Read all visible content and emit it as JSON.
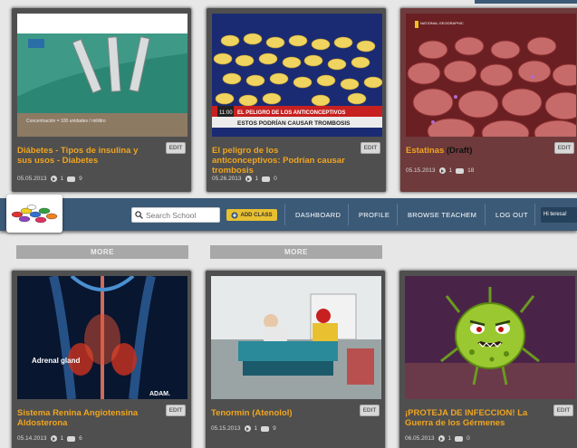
{
  "navbar": {
    "search_placeholder": "Search School",
    "add_class": "ADD CLASS",
    "links": [
      "DASHBOARD",
      "PROFILE",
      "BROWSE TEACHEM",
      "LOG OUT"
    ],
    "user": "Hi teresa!"
  },
  "more_label": "MORE",
  "cards": [
    {
      "title": "Diábetes - Tipos de insulina y sus usos - Diabetes",
      "tag": "",
      "date": "05.05.2013",
      "views": "1",
      "comments": "9",
      "edit": "EDIT",
      "caption": "Concentración = 100 unidades / mililitro"
    },
    {
      "title": "El peligro de los anticonceptivos: Podrían causar trombosis",
      "tag": "",
      "date": "05.26.2013",
      "views": "1",
      "comments": "0",
      "edit": "EDIT",
      "caption": "EL PELIGRO DE LOS ANTICONCEPTIVOS",
      "caption2": "ESTOS PODRÍAN CAUSAR TROMBOSIS",
      "clock": "11:00"
    },
    {
      "title": "Estatinas",
      "tag": " (Draft)",
      "date": "05.15.2013",
      "views": "1",
      "comments": "18",
      "edit": "EDIT",
      "caption": "NATIONAL GEOGRAPHIC"
    },
    {
      "title": "Sistema Renina Angiotensina Aldosterona",
      "tag": "",
      "date": "05.14.2013",
      "views": "1",
      "comments": "6",
      "edit": "EDIT",
      "caption": "Adrenal gland",
      "caption2": "ADAM."
    },
    {
      "title": "Tenormin (Atenolol)",
      "tag": "",
      "date": "05.15.2013",
      "views": "1",
      "comments": "9",
      "edit": "EDIT"
    },
    {
      "title": "¡PROTEJA DE INFECCION! La Guerra de los Gérmenes",
      "tag": "",
      "date": "06.05.2013",
      "views": "1",
      "comments": "0",
      "edit": "EDIT"
    }
  ]
}
